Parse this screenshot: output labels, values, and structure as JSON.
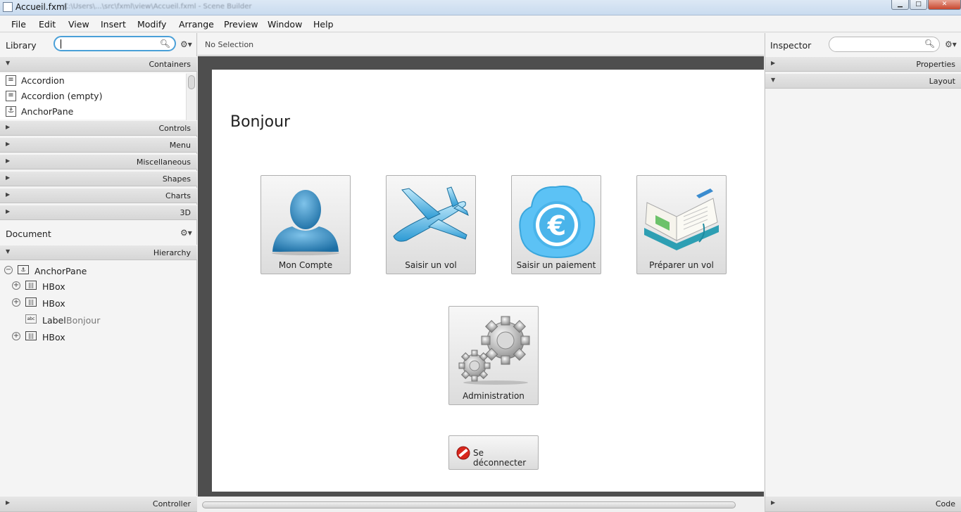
{
  "window": {
    "title": "Accueil.fxml",
    "subtitle": "C:\\Users\\...\\src\\fxml\\view\\Accueil.fxml - Scene Builder",
    "minimize_glyph": "▁",
    "maximize_glyph": "□",
    "close_glyph": "✕"
  },
  "menu": [
    "File",
    "Edit",
    "View",
    "Insert",
    "Modify",
    "Arrange",
    "Preview",
    "Window",
    "Help"
  ],
  "library": {
    "title": "Library",
    "search_value": "",
    "sections": [
      "Containers",
      "Controls",
      "Menu",
      "Miscellaneous",
      "Shapes",
      "Charts",
      "3D"
    ],
    "containers": [
      {
        "label": "Accordion",
        "icon": "accordion-icon"
      },
      {
        "label": "Accordion  (empty)",
        "icon": "accordion-icon"
      },
      {
        "label": "AnchorPane",
        "icon": "anchor-icon"
      }
    ]
  },
  "document": {
    "title": "Document",
    "section": "Hierarchy",
    "tree": [
      {
        "label": "AnchorPane",
        "sub": "",
        "toggle": "−"
      },
      {
        "label": "HBox",
        "sub": "",
        "toggle": "+"
      },
      {
        "label": "HBox",
        "sub": "",
        "toggle": "+"
      },
      {
        "label": "Label",
        "sub": "Bonjour",
        "toggle": ""
      },
      {
        "label": "HBox",
        "sub": "",
        "toggle": "+"
      }
    ],
    "footer": "Controller"
  },
  "center": {
    "selection": "No Selection",
    "heading": "Bonjour",
    "tiles": [
      {
        "label": "Mon Compte",
        "icon": "user-icon"
      },
      {
        "label": "Saisir un vol",
        "icon": "airplane-icon"
      },
      {
        "label": "Saisir un paiement",
        "icon": "euro-cloud-icon"
      },
      {
        "label": "Préparer un vol",
        "icon": "book-icon"
      },
      {
        "label": "Administration",
        "icon": "gears-icon"
      }
    ],
    "logout_label": "Se déconnecter"
  },
  "inspector": {
    "title": "Inspector",
    "search_value": "",
    "sections": [
      "Properties",
      "Layout"
    ],
    "footer": "Code"
  },
  "colors": {
    "accent": "#4aa0d8",
    "canvas_border": "#4e4e4e"
  }
}
